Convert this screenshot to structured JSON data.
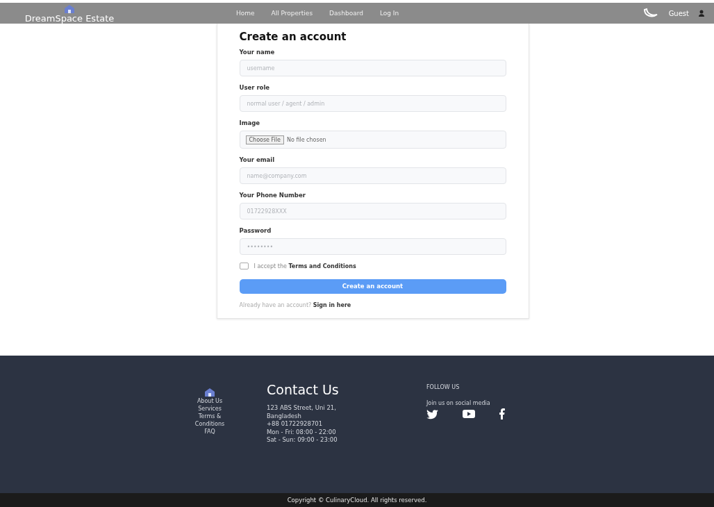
{
  "navbar": {
    "brand": "DreamSpace Estate",
    "links": [
      {
        "label": "Home"
      },
      {
        "label": "All Properties"
      },
      {
        "label": "Dashboard"
      },
      {
        "label": "Log In"
      }
    ],
    "user": "Guest"
  },
  "form": {
    "title": "Create an account",
    "fields": [
      {
        "kind": "text",
        "label": "Your name",
        "placeholder": "username"
      },
      {
        "kind": "text",
        "label": "User role",
        "placeholder": "normal user / agent / admin"
      },
      {
        "kind": "file",
        "label": "Image",
        "button": "Choose File",
        "status": "No file chosen"
      },
      {
        "kind": "text",
        "label": "Your email",
        "placeholder": "name@company.com"
      },
      {
        "kind": "text",
        "label": "Your Phone Number",
        "placeholder": "01722928XXX"
      },
      {
        "kind": "text",
        "label": "Password",
        "placeholder": "••••••••"
      }
    ],
    "terms": {
      "checked": false,
      "text": "I accept the",
      "link": "Terms and Conditions"
    },
    "submit": "Create an account",
    "signin_text": "Already have an account?",
    "signin_link": "Sign in here"
  },
  "footer": {
    "links": [
      "About Us",
      "Services",
      "Terms & Conditions",
      "FAQ"
    ],
    "contact_title": "Contact Us",
    "contact_lines": [
      "123 ABS Street, Uni 21, Bangladesh",
      "+88 01722928701",
      "Mon - Fri: 08:00 - 22:00",
      "Sat - Sun: 09:00 - 23:00"
    ],
    "follow_title": "FOLLOW US",
    "follow_text": "Join us on social media"
  },
  "copyright": "Copyright © CulinaryCloud. All rights reserved."
}
